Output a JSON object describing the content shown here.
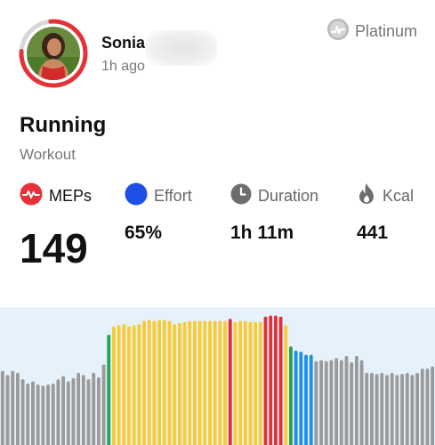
{
  "user": {
    "name": "Sonia",
    "time_ago": "1h ago",
    "avatar_ring_color": "#e53238"
  },
  "tier": {
    "label": "Platinum",
    "icon": "platinum-badge-icon"
  },
  "workout": {
    "title": "Running",
    "subtitle": "Workout"
  },
  "metrics": {
    "meps": {
      "label": "MEPs",
      "value": "149",
      "icon": "heart-pulse-icon",
      "icon_color": "#e53238"
    },
    "effort": {
      "label": "Effort",
      "value": "65%",
      "icon": "effort-dot-icon",
      "icon_color": "#1e4fe6"
    },
    "duration": {
      "label": "Duration",
      "value": "1h 11m",
      "icon": "clock-icon",
      "icon_color": "#6d6d6d"
    },
    "kcal": {
      "label": "Kcal",
      "value": "441",
      "icon": "flame-icon",
      "icon_color": "#6d6d6d"
    }
  },
  "chart_data": {
    "type": "bar",
    "zone_colors": {
      "gray": "#9a9a9a",
      "blue": "#1e90e8",
      "green": "#2aa54a",
      "yellow": "#f7cc37",
      "red": "#e0313a"
    },
    "ylim": [
      0,
      130
    ],
    "bars": [
      {
        "v": 70,
        "z": "gray"
      },
      {
        "v": 66,
        "z": "gray"
      },
      {
        "v": 70,
        "z": "gray"
      },
      {
        "v": 68,
        "z": "gray"
      },
      {
        "v": 62,
        "z": "gray"
      },
      {
        "v": 58,
        "z": "gray"
      },
      {
        "v": 60,
        "z": "gray"
      },
      {
        "v": 57,
        "z": "gray"
      },
      {
        "v": 56,
        "z": "gray"
      },
      {
        "v": 57,
        "z": "gray"
      },
      {
        "v": 58,
        "z": "gray"
      },
      {
        "v": 62,
        "z": "gray"
      },
      {
        "v": 65,
        "z": "gray"
      },
      {
        "v": 60,
        "z": "gray"
      },
      {
        "v": 63,
        "z": "gray"
      },
      {
        "v": 68,
        "z": "gray"
      },
      {
        "v": 66,
        "z": "gray"
      },
      {
        "v": 62,
        "z": "gray"
      },
      {
        "v": 68,
        "z": "gray"
      },
      {
        "v": 64,
        "z": "gray"
      },
      {
        "v": 76,
        "z": "gray"
      },
      {
        "v": 104,
        "z": "green"
      },
      {
        "v": 112,
        "z": "yellow"
      },
      {
        "v": 113,
        "z": "yellow"
      },
      {
        "v": 114,
        "z": "yellow"
      },
      {
        "v": 112,
        "z": "yellow"
      },
      {
        "v": 113,
        "z": "yellow"
      },
      {
        "v": 114,
        "z": "yellow"
      },
      {
        "v": 117,
        "z": "yellow"
      },
      {
        "v": 118,
        "z": "yellow"
      },
      {
        "v": 117,
        "z": "yellow"
      },
      {
        "v": 118,
        "z": "yellow"
      },
      {
        "v": 118,
        "z": "yellow"
      },
      {
        "v": 117,
        "z": "yellow"
      },
      {
        "v": 114,
        "z": "yellow"
      },
      {
        "v": 115,
        "z": "yellow"
      },
      {
        "v": 116,
        "z": "yellow"
      },
      {
        "v": 117,
        "z": "yellow"
      },
      {
        "v": 117,
        "z": "yellow"
      },
      {
        "v": 117,
        "z": "yellow"
      },
      {
        "v": 117,
        "z": "yellow"
      },
      {
        "v": 117,
        "z": "yellow"
      },
      {
        "v": 117,
        "z": "yellow"
      },
      {
        "v": 117,
        "z": "yellow"
      },
      {
        "v": 117,
        "z": "yellow"
      },
      {
        "v": 119,
        "z": "red"
      },
      {
        "v": 116,
        "z": "yellow"
      },
      {
        "v": 117,
        "z": "yellow"
      },
      {
        "v": 117,
        "z": "yellow"
      },
      {
        "v": 116,
        "z": "yellow"
      },
      {
        "v": 116,
        "z": "yellow"
      },
      {
        "v": 116,
        "z": "yellow"
      },
      {
        "v": 121,
        "z": "red"
      },
      {
        "v": 122,
        "z": "red"
      },
      {
        "v": 122,
        "z": "red"
      },
      {
        "v": 121,
        "z": "red"
      },
      {
        "v": 113,
        "z": "yellow"
      },
      {
        "v": 93,
        "z": "green"
      },
      {
        "v": 89,
        "z": "blue"
      },
      {
        "v": 88,
        "z": "blue"
      },
      {
        "v": 85,
        "z": "blue"
      },
      {
        "v": 85,
        "z": "blue"
      },
      {
        "v": 79,
        "z": "gray"
      },
      {
        "v": 80,
        "z": "gray"
      },
      {
        "v": 79,
        "z": "gray"
      },
      {
        "v": 80,
        "z": "gray"
      },
      {
        "v": 82,
        "z": "gray"
      },
      {
        "v": 80,
        "z": "gray"
      },
      {
        "v": 84,
        "z": "gray"
      },
      {
        "v": 78,
        "z": "gray"
      },
      {
        "v": 84,
        "z": "gray"
      },
      {
        "v": 80,
        "z": "gray"
      },
      {
        "v": 68,
        "z": "gray"
      },
      {
        "v": 68,
        "z": "gray"
      },
      {
        "v": 67,
        "z": "gray"
      },
      {
        "v": 68,
        "z": "gray"
      },
      {
        "v": 66,
        "z": "gray"
      },
      {
        "v": 68,
        "z": "gray"
      },
      {
        "v": 66,
        "z": "gray"
      },
      {
        "v": 67,
        "z": "gray"
      },
      {
        "v": 68,
        "z": "gray"
      },
      {
        "v": 66,
        "z": "gray"
      },
      {
        "v": 68,
        "z": "gray"
      },
      {
        "v": 72,
        "z": "gray"
      },
      {
        "v": 72,
        "z": "gray"
      },
      {
        "v": 74,
        "z": "gray"
      }
    ]
  }
}
